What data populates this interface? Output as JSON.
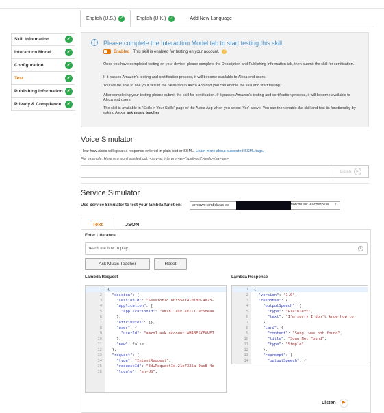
{
  "lang_tabs": [
    {
      "label": "English (U.S.)",
      "checked": true,
      "active": true
    },
    {
      "label": "English (U.K.)",
      "checked": true,
      "active": false
    },
    {
      "label": "Add New Language",
      "checked": false,
      "active": false
    }
  ],
  "sidebar": {
    "items": [
      {
        "label": "Skill Information",
        "checked": true,
        "active": false
      },
      {
        "label": "Interaction Model",
        "checked": true,
        "active": false
      },
      {
        "label": "Configuration",
        "checked": true,
        "active": false
      },
      {
        "label": "Test",
        "checked": true,
        "active": true
      },
      {
        "label": "Publishing Information",
        "checked": true,
        "active": false
      },
      {
        "label": "Privacy & Compliance",
        "checked": true,
        "active": false
      }
    ]
  },
  "info": {
    "headline": "Please complete the Interaction Model tab to start testing this skill.",
    "enabled_label": "Enabled",
    "enabled_text": "This skill is enabled for testing on your account.",
    "paragraphs": [
      "Once you have completed testing on your device, please complete the Description and Publishing Information tab, then submit the skill for certification.",
      "If it passes Amazon's testing and certification process, it will become available to Alexa end users.",
      "You will be able to see your skill in the Skills tab in Alexa App and you can enable the skill and start testing.",
      "After completing your testing please submit the skill for certification. If it passes Amazon's testing and certification process, it will become available to Alexa end users",
      "The skill is available in \"Skills > Your Skills\" page of the Alexa App when you select 'Yes' above. You can then enable the skill and test its functionality by asking Alexa,"
    ],
    "last_bold": "ask music teacher"
  },
  "voice": {
    "title": "Voice Simulator",
    "desc": "Hear how Alexa will speak a response entered in plain text or SSML.",
    "link": "Learn more about supported SSML tags.",
    "example": "For example: Here is a word spelled out: <say-as interpret-as=\"spell-out\">hello</say-as>.",
    "listen": "Listen"
  },
  "service": {
    "title": "Service Simulator",
    "label": "Use Service Simulator to test your lambda function:",
    "select_prefix": "arn:aws:lambda:us-ea",
    "select_suffix": "tion:musicTeacherBlue",
    "select_arrow": "↕",
    "tabs": [
      "Text",
      "JSON"
    ],
    "utterance_label": "Enter Utterance",
    "utterance_value": "teach me how to play",
    "ask_button": "Ask Music Teacher",
    "reset_button": "Reset",
    "request_label": "Lambda Request",
    "response_label": "Lambda Response",
    "listen": "Listen"
  },
  "request_lines": [
    "{",
    "  \"session\": {",
    "    \"sessionId\": \"SessionId.80f55e14-0180-4e23-",
    "    \"application\": {",
    "      \"applicationId\": \"amzn1.ask.skill.9c6beaa",
    "    },",
    "    \"attributes\": {},",
    "    \"user\": {",
    "      \"userId\": \"amzn1.ask.account.AHABESKEVVF7",
    "    },",
    "    \"new\": false",
    "  },",
    "  \"request\": {",
    "    \"type\": \"IntentRequest\",",
    "    \"requestId\": \"EdwRequestId.21e7325a-0ae8-4e",
    "    \"locale\": \"en-US\","
  ],
  "response_lines": [
    "{",
    "  \"version\": \"1.0\",",
    "  \"response\": {",
    "    \"outputSpeech\": {",
    "      \"type\": \"PlainText\",",
    "      \"text\": \"I'm sorry I don't know how to",
    "    },",
    "    \"card\": {",
    "      \"content\": \"Song  was not found\",",
    "      \"title\": \"Song Not Found\",",
    "      \"type\": \"Simple\"",
    "    },",
    "    \"reprompt\": {",
    "      \"outputSpeech\": {"
  ]
}
